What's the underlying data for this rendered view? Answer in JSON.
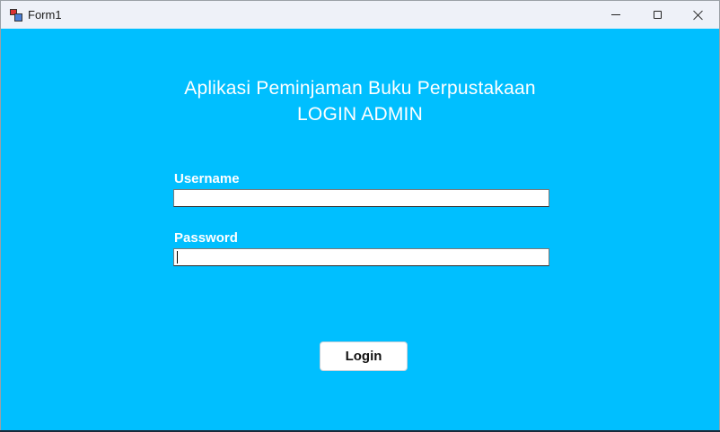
{
  "window": {
    "title": "Form1",
    "controls": {
      "minimize_icon": "minimize-icon",
      "maximize_icon": "maximize-icon",
      "close_icon": "close-icon"
    },
    "background_color": "#00BFFF"
  },
  "header": {
    "line1": "Aplikasi Peminjaman Buku Perpustakaan",
    "line2": "LOGIN ADMIN"
  },
  "form": {
    "username_label": "Username",
    "username_value": "",
    "password_label": "Password",
    "password_value": "",
    "login_label": "Login"
  }
}
